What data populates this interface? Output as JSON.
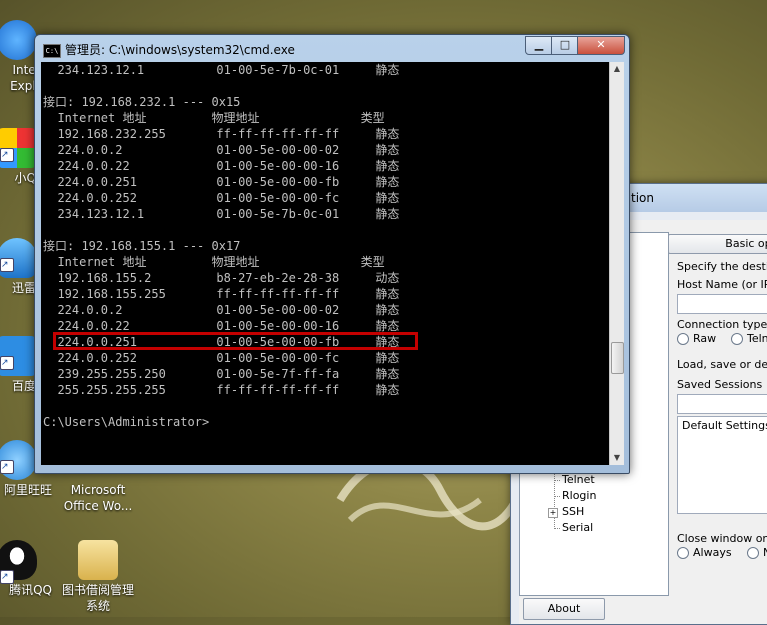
{
  "desktop": {
    "icons": [
      {
        "label": "Intern",
        "label2": "Explor"
      },
      {
        "label": "小Q书"
      },
      {
        "label": "迅雷下"
      },
      {
        "label": "百度云"
      },
      {
        "label": "阿里旺旺"
      },
      {
        "label": "Microsoft",
        "label2": "Office Wo..."
      },
      {
        "label": "腾讯QQ"
      },
      {
        "label": "图书借阅管理",
        "label2": "系统"
      }
    ]
  },
  "putty": {
    "title_fragment": "tion",
    "tab_label": "Basic opti",
    "specify_dest": "Specify the destinat",
    "host_label": "Host Name (or IP a",
    "conn_type_label": "Connection type:",
    "raw_label": "Raw",
    "telnet_label": "Teln",
    "load_save_label": "Load, save or delet",
    "saved_sessions_label": "Saved Sessions",
    "default_settings": "Default Settings",
    "tree_items": [
      "Telnet",
      "Rlogin",
      "SSH",
      "Serial"
    ],
    "close_window_label": "Close window on ex",
    "always_label": "Always",
    "never_label": "N",
    "about_button": "About"
  },
  "cmd": {
    "title": "管理员: C:\\windows\\system32\\cmd.exe",
    "icon_text": "C:\\",
    "lines": [
      "  234.123.12.1          01-00-5e-7b-0c-01     静态",
      "",
      "接口: 192.168.232.1 --- 0x15",
      "  Internet 地址         物理地址              类型",
      "  192.168.232.255       ff-ff-ff-ff-ff-ff     静态",
      "  224.0.0.2             01-00-5e-00-00-02     静态",
      "  224.0.0.22            01-00-5e-00-00-16     静态",
      "  224.0.0.251           01-00-5e-00-00-fb     静态",
      "  224.0.0.252           01-00-5e-00-00-fc     静态",
      "  234.123.12.1          01-00-5e-7b-0c-01     静态",
      "",
      "接口: 192.168.155.1 --- 0x17",
      "  Internet 地址         物理地址              类型",
      "  192.168.155.2         b8-27-eb-2e-28-38     动态",
      "  192.168.155.255       ff-ff-ff-ff-ff-ff     静态",
      "  224.0.0.2             01-00-5e-00-00-02     静态",
      "  224.0.0.22            01-00-5e-00-00-16     静态",
      "  224.0.0.251           01-00-5e-00-00-fb     静态",
      "  224.0.0.252           01-00-5e-00-00-fc     静态",
      "  239.255.255.250       01-00-5e-7f-ff-fa     静态",
      "  255.255.255.255       ff-ff-ff-ff-ff-ff     静态",
      "",
      "C:\\Users\\Administrator>"
    ]
  },
  "colors": {
    "highlight": "#c40000",
    "console_bg": "#000000",
    "console_fg": "#c0c0c0"
  }
}
